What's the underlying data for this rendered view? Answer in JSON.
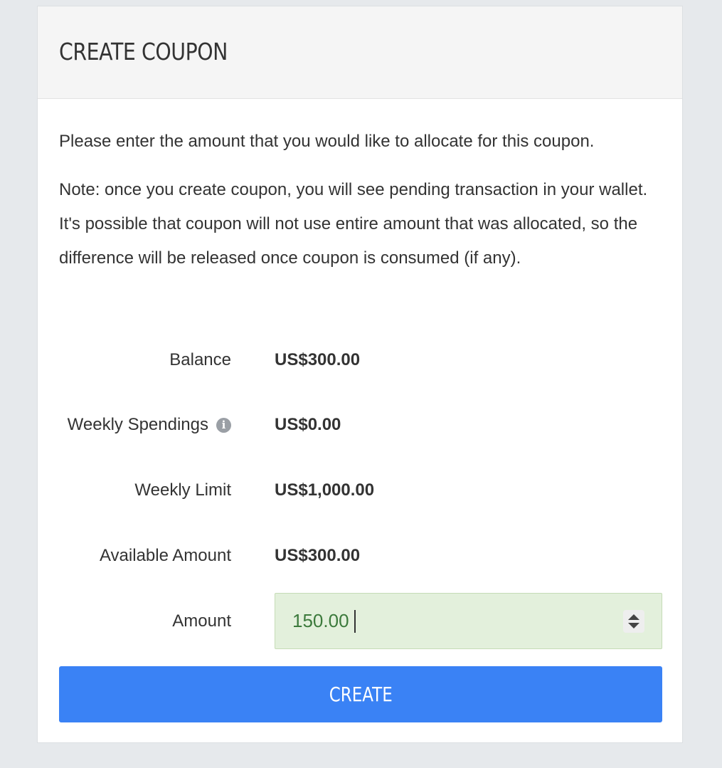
{
  "header": {
    "title": "CREATE COUPON"
  },
  "body": {
    "intro": "Please enter the amount that you would like to allocate for this coupon.",
    "note": "Note: once you create coupon, you will see pending transaction in your wallet. It's possible that coupon will not use entire amount that was allocated, so the difference will be released once coupon is consumed (if any)."
  },
  "details": {
    "balance_label": "Balance",
    "balance_value": "US$300.00",
    "weekly_spendings_label": "Weekly Spendings",
    "weekly_spendings_icon": "info-icon",
    "weekly_spendings_value": "US$0.00",
    "weekly_limit_label": "Weekly Limit",
    "weekly_limit_value": "US$1,000.00",
    "available_amount_label": "Available Amount",
    "available_amount_value": "US$300.00"
  },
  "form": {
    "amount_label": "Amount",
    "amount_value": "150.00",
    "create_label": "CREATE"
  },
  "colors": {
    "page_background": "#e6e9ec",
    "header_background": "#f5f5f5",
    "input_background": "#e3f0dc",
    "input_text": "#3c7a3c",
    "button_background": "#3a82f5"
  }
}
